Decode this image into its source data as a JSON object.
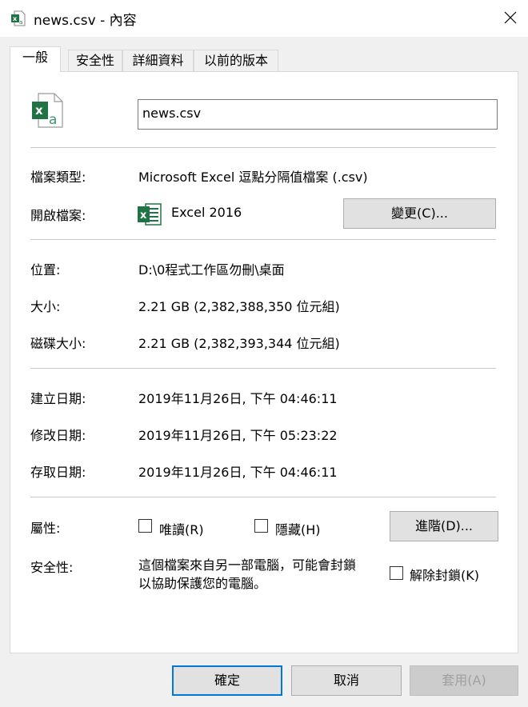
{
  "window": {
    "title": "news.csv - 內容",
    "close_icon": "close-icon"
  },
  "tabs": [
    "一般",
    "安全性",
    "詳細資料",
    "以前的版本"
  ],
  "general": {
    "filename": "news.csv",
    "type_label": "檔案類型:",
    "type_value": "Microsoft Excel 逗點分隔值檔案 (.csv)",
    "open_label": "開啟檔案:",
    "open_value": "Excel 2016",
    "change_button": "變更(C)...",
    "location_label": "位置:",
    "location_value": "D:\\0程式工作區勿刪\\桌面",
    "size_label": "大小:",
    "size_value": "2.21 GB (2,382,388,350 位元組)",
    "disk_label": "磁碟大小:",
    "disk_value": "2.21 GB (2,382,393,344 位元組)",
    "created_label": "建立日期:",
    "created_value": "2019年11月26日, 下午 04:46:11",
    "modified_label": "修改日期:",
    "modified_value": "2019年11月26日, 下午 05:23:22",
    "accessed_label": "存取日期:",
    "accessed_value": "2019年11月26日, 下午 04:46:11",
    "attributes_label": "屬性:",
    "readonly_label": "唯讀(R)",
    "hidden_label": "隱藏(H)",
    "advanced_button": "進階(D)...",
    "security_label": "安全性:",
    "security_text_1": "這個檔案來自另一部電腦，可能會封鎖",
    "security_text_2": "以協助保護您的電腦。",
    "unblock_label": "解除封鎖(K)"
  },
  "footer": {
    "ok": "確定",
    "cancel": "取消",
    "apply": "套用(A)"
  },
  "colors": {
    "excel_green": "#217346",
    "accent": "#0078d7"
  }
}
